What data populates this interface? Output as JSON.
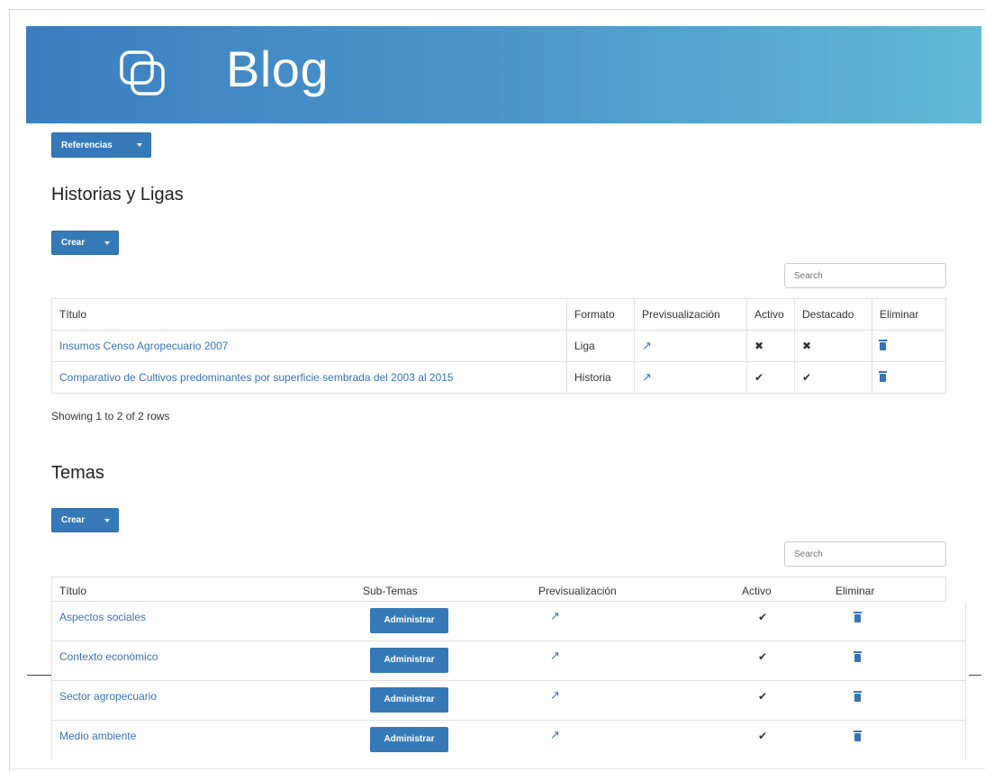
{
  "header": {
    "brand": "Blog",
    "logo_icon": "stacked-squares-icon",
    "colors": {
      "from": "#3b7fc1",
      "to": "#62b9d6"
    }
  },
  "references_button": {
    "label": "Referencias"
  },
  "stories": {
    "title": "Historias y Ligas",
    "create_label": "Crear",
    "search_placeholder": "Search",
    "columns": [
      "Título",
      "Formato",
      "Previsualización",
      "Activo",
      "Destacado",
      "Eliminar"
    ],
    "rows": [
      {
        "title": "Insumos Censo Agropecuario 2007",
        "format": "Liga",
        "active": "✖",
        "featured": "✖"
      },
      {
        "title": "Comparativo de Cultivos predominantes por superficie sembrada del 2003 al 2015",
        "format": "Historia",
        "active": "✔",
        "featured": "✔"
      }
    ],
    "footer": "Showing 1 to 2 of 2 rows"
  },
  "topics": {
    "title": "Temas",
    "create_label": "Crear",
    "search_placeholder": "Search",
    "columns": [
      "Título",
      "Sub-Temas",
      "Previsualización",
      "Activo",
      "Eliminar"
    ],
    "admin_label": "Administrar",
    "rows": [
      {
        "title": "Aspectos sociales",
        "active": "✔"
      },
      {
        "title": "Contexto económico",
        "active": "✔"
      },
      {
        "title": "Sector agropecuario",
        "active": "✔"
      },
      {
        "title": "Medio ambiente",
        "active": "✔"
      }
    ]
  },
  "icons": {
    "preview": "external-link-icon",
    "delete": "trash-icon"
  }
}
